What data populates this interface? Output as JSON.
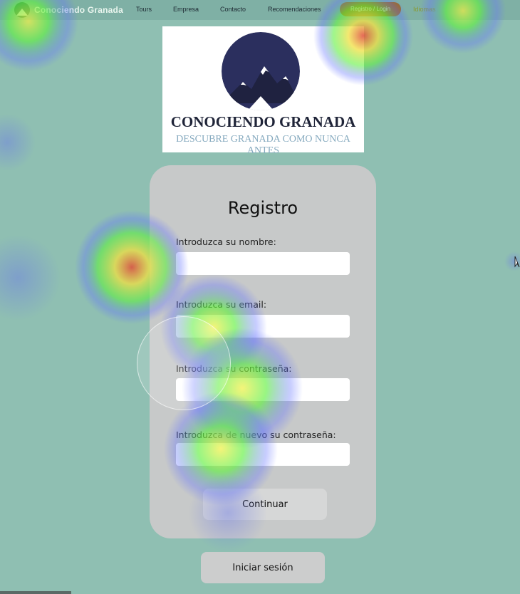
{
  "nav": {
    "brand": "Conociendo Granada",
    "items": [
      "Tours",
      "Empresa",
      "Contacto",
      "Recomendaciones"
    ],
    "login": "Registro / Login",
    "language": "Idiomas"
  },
  "logo": {
    "title": "CONOCIENDO GRANADA",
    "subtitle": "DESCUBRE GRANADA COMO NUNCA ANTES"
  },
  "form": {
    "title": "Registro",
    "fields": [
      {
        "label": "Introduzca su nombre:",
        "value": ""
      },
      {
        "label": "Introduzca su email:",
        "value": ""
      },
      {
        "label": "Introduzca su contraseña:",
        "value": ""
      },
      {
        "label": "Introduzca de nuevo su contraseña:",
        "value": ""
      }
    ],
    "continue_label": "Continuar"
  },
  "login_button": "Iniciar sesión",
  "colors": {
    "background": "#8fbfb2",
    "card": "#c7c9c9",
    "login_pill": "#a06a1a",
    "logo_navy": "#2b2f5e"
  }
}
